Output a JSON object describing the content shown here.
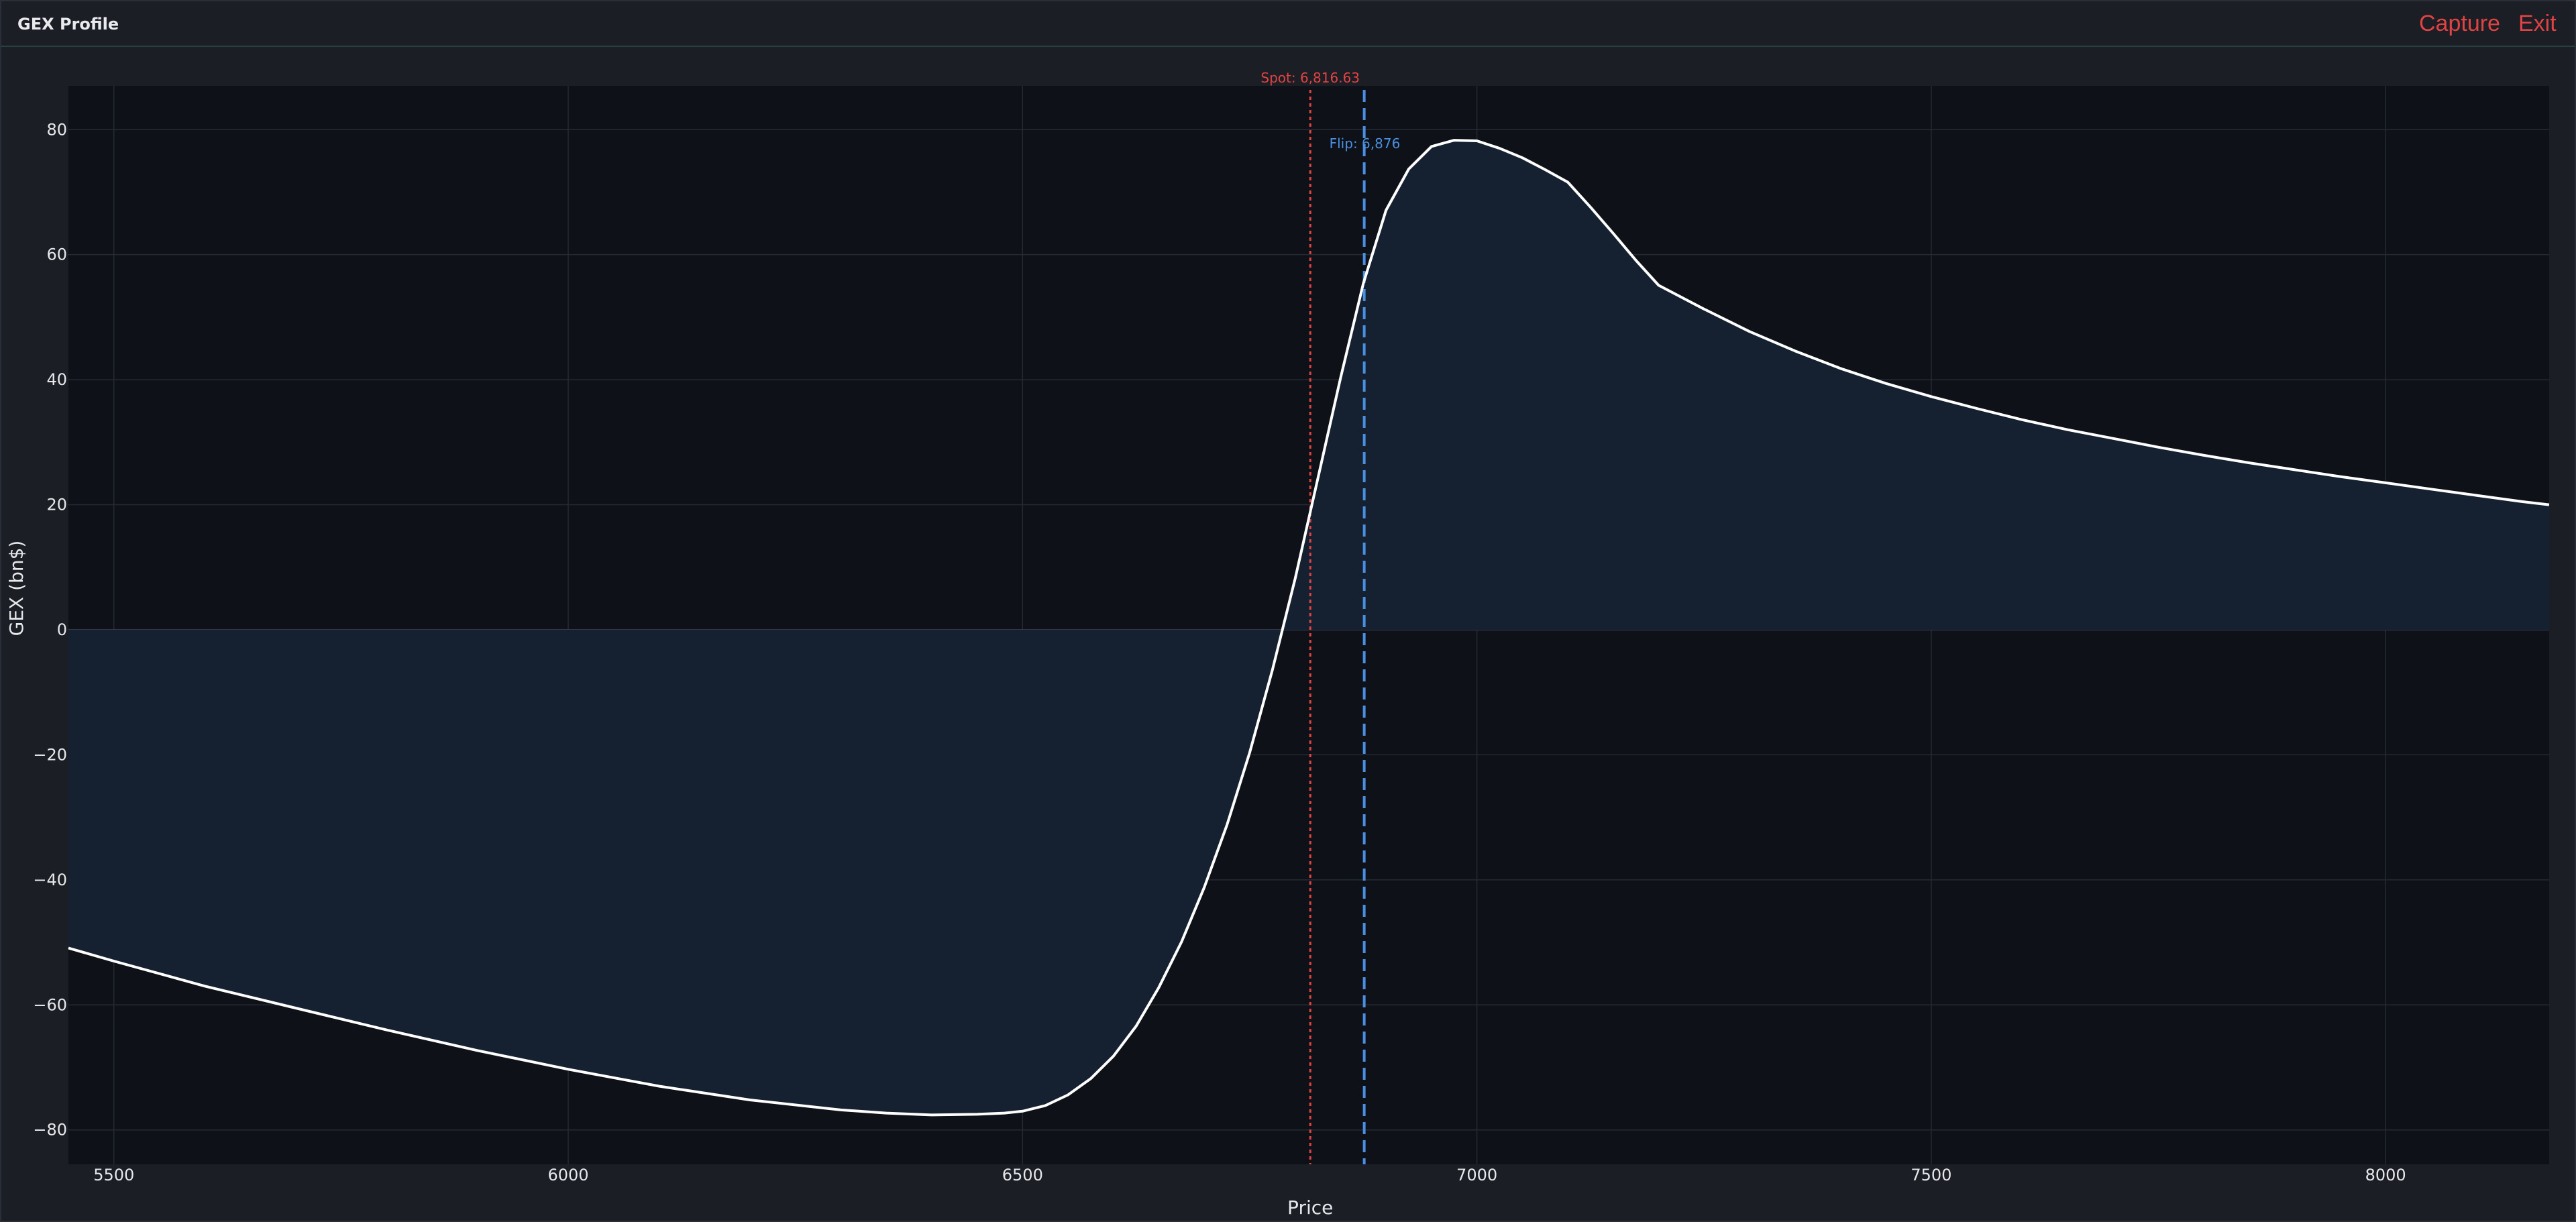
{
  "window": {
    "title": "GEX Profile",
    "capture_label": "Capture",
    "exit_label": "Exit"
  },
  "colors": {
    "background": "#1b1e24",
    "plot_background": "#0e1117",
    "grid": "#262b33",
    "fill": "#152130",
    "curve": "#ffffff",
    "spot": "#e04343",
    "flip": "#4a90e2",
    "menu_text": "#e04343"
  },
  "chart_data": {
    "type": "area",
    "xlabel": "Price",
    "ylabel": "GEX (bn$)",
    "xlim": [
      5450,
      8180
    ],
    "ylim": [
      -85.5,
      87
    ],
    "x_ticks": [
      5500,
      6000,
      6500,
      7000,
      7500,
      8000
    ],
    "y_ticks": [
      80,
      60,
      40,
      20,
      0,
      -20,
      -40,
      -60,
      -80
    ],
    "x_tick_labels": [
      "5500",
      "6000",
      "6500",
      "7000",
      "7500",
      "8000"
    ],
    "y_tick_labels": [
      "80",
      "60",
      "40",
      "20",
      "0",
      "−20",
      "−40",
      "−60",
      "−80"
    ],
    "grid": true,
    "fill_to_zero": true,
    "series": [
      {
        "x": [
          5450,
          5500,
          5600,
          5700,
          5800,
          5900,
          6000,
          6100,
          6200,
          6300,
          6350,
          6400,
          6450,
          6480,
          6500,
          6525,
          6550,
          6575,
          6600,
          6625,
          6650,
          6675,
          6700,
          6725,
          6750,
          6775,
          6800,
          6825,
          6850,
          6875,
          6900,
          6925,
          6950,
          6975,
          7000,
          7025,
          7050,
          7075,
          7100,
          7125,
          7150,
          7175,
          7200,
          7250,
          7300,
          7350,
          7400,
          7450,
          7500,
          7550,
          7600,
          7650,
          7700,
          7750,
          7800,
          7850,
          7900,
          7950,
          8000,
          8050,
          8100,
          8150,
          8180
        ],
        "y": [
          -50.9,
          -53,
          -57,
          -60.5,
          -64,
          -67.3,
          -70.3,
          -73,
          -75.2,
          -76.8,
          -77.3,
          -77.6,
          -77.5,
          -77.3,
          -77,
          -76.1,
          -74.4,
          -71.8,
          -68.2,
          -63.4,
          -57.2,
          -49.9,
          -41.2,
          -31.2,
          -19.6,
          -6.4,
          8.2,
          24.2,
          40.3,
          55.4,
          67.1,
          73.7,
          77.3,
          78.3,
          78.2,
          77,
          75.5,
          73.6,
          71.6,
          67.6,
          63.4,
          59.1,
          55.1,
          51.3,
          47.7,
          44.6,
          41.8,
          39.4,
          37.3,
          35.4,
          33.6,
          32,
          30.6,
          29.2,
          27.9,
          26.7,
          25.6,
          24.5,
          23.5,
          22.5,
          21.5,
          20.5,
          20
        ]
      }
    ],
    "spot": {
      "label": "Spot: 6,816.63",
      "value": 6816.63
    },
    "flip": {
      "label": "Flip: 6,876",
      "value": 6876
    }
  }
}
